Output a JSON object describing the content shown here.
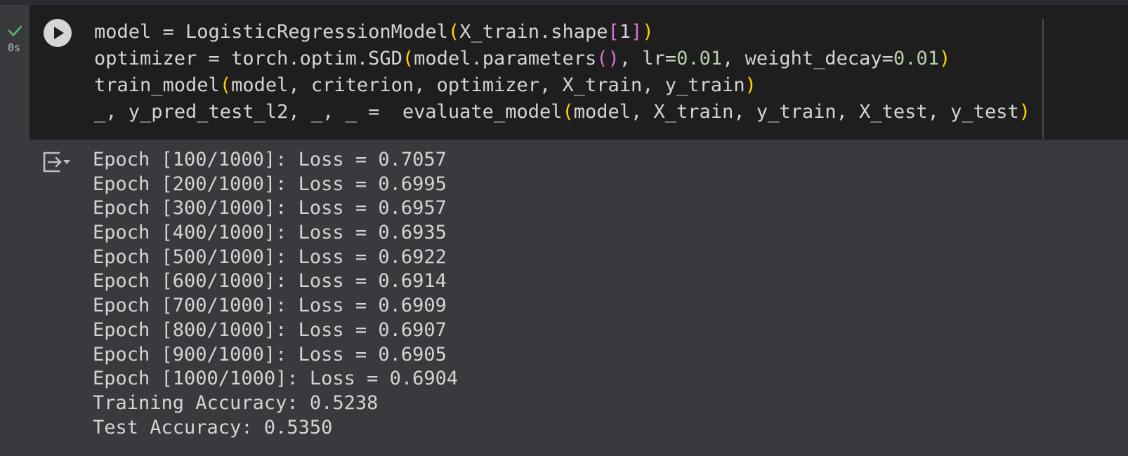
{
  "cell": {
    "exec_time": "0s",
    "code_lines": [
      [
        {
          "t": "model = LogisticRegressionModel",
          "c": "default"
        },
        {
          "t": "(",
          "c": "paren"
        },
        {
          "t": "X_train.shape",
          "c": "default"
        },
        {
          "t": "[",
          "c": "bracket"
        },
        {
          "t": "1",
          "c": "default"
        },
        {
          "t": "]",
          "c": "bracket"
        },
        {
          "t": ")",
          "c": "paren"
        }
      ],
      [
        {
          "t": "optimizer = torch.optim.SGD",
          "c": "default"
        },
        {
          "t": "(",
          "c": "paren"
        },
        {
          "t": "model.parameters",
          "c": "default"
        },
        {
          "t": "()",
          "c": "bracket"
        },
        {
          "t": ", lr=",
          "c": "default"
        },
        {
          "t": "0.01",
          "c": "num"
        },
        {
          "t": ", weight_decay=",
          "c": "default"
        },
        {
          "t": "0.01",
          "c": "num"
        },
        {
          "t": ")",
          "c": "paren"
        }
      ],
      [
        {
          "t": "train_model",
          "c": "default"
        },
        {
          "t": "(",
          "c": "paren"
        },
        {
          "t": "model, criterion, optimizer, X_train, y_train",
          "c": "default"
        },
        {
          "t": ")",
          "c": "paren"
        }
      ],
      [
        {
          "t": "_, y_pred_test_l2, _, _ =  evaluate_model",
          "c": "default"
        },
        {
          "t": "(",
          "c": "paren"
        },
        {
          "t": "model, X_train, y_train, X_test, y_test",
          "c": "default"
        },
        {
          "t": ")",
          "c": "paren"
        }
      ]
    ]
  },
  "output": {
    "lines": [
      "Epoch [100/1000]: Loss = 0.7057",
      "Epoch [200/1000]: Loss = 0.6995",
      "Epoch [300/1000]: Loss = 0.6957",
      "Epoch [400/1000]: Loss = 0.6935",
      "Epoch [500/1000]: Loss = 0.6922",
      "Epoch [600/1000]: Loss = 0.6914",
      "Epoch [700/1000]: Loss = 0.6909",
      "Epoch [800/1000]: Loss = 0.6907",
      "Epoch [900/1000]: Loss = 0.6905",
      "Epoch [1000/1000]: Loss = 0.6904",
      "Training Accuracy: 0.5238",
      "Test Accuracy: 0.5350"
    ]
  },
  "colors": {
    "check": "#5bb974",
    "paren": "#ffd700",
    "bracket": "#da70d6",
    "number": "#b5cea8",
    "text": "#d4d4d4"
  },
  "icons": {
    "status": "checkmark-icon",
    "run": "play-icon",
    "output_toggle": "output-collapse-icon"
  }
}
